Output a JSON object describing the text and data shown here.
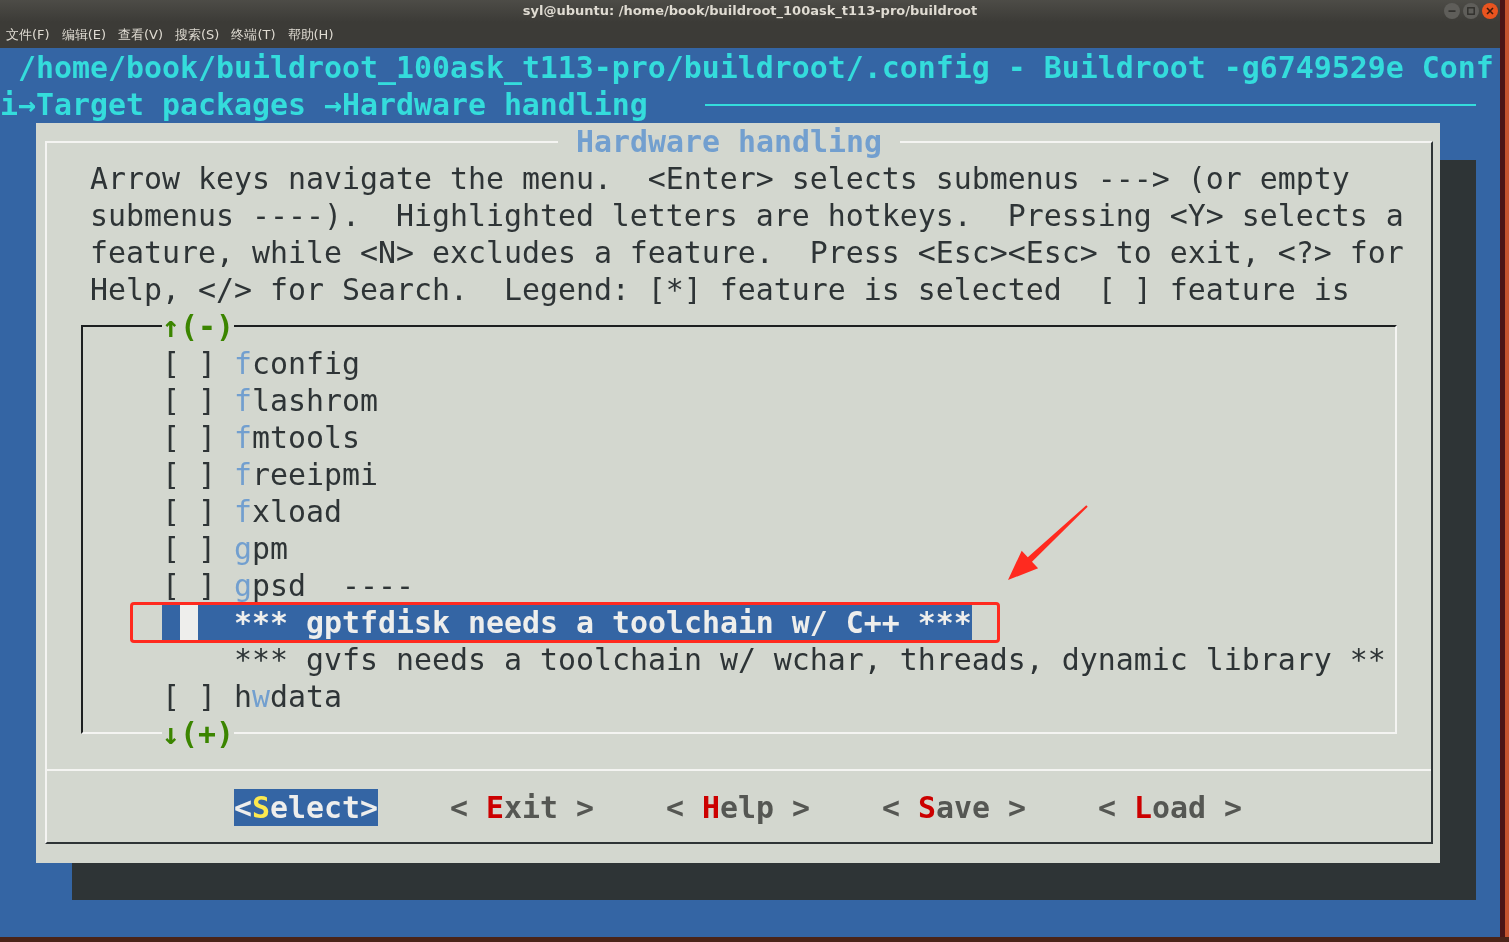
{
  "window": {
    "title": "syl@ubuntu: /home/book/buildroot_100ask_t113-pro/buildroot"
  },
  "menu_bar": [
    "文件(F)",
    "编辑(E)",
    "查看(V)",
    "搜索(S)",
    "终端(T)",
    "帮助(H)"
  ],
  "terminal": {
    "header": "/home/book/buildroot_100ask_t113-pro/buildroot/.config - Buildroot -g6749529e Conf",
    "breadcrumb": "i→Target packages →Hardware handling",
    "dialog": {
      "title": "Hardware handling",
      "help_text": "Arrow keys navigate the menu.  <Enter> selects submenus ---> (or empty submenus ----).  Highlighted letters are hotkeys.  Pressing <Y> selects a feature, while <N> excludes a feature.  Press <Esc><Esc> to exit, <?> for Help, </> for Search.  Legend: [*] feature is selected  [ ] feature is",
      "scroll_up": "↑(-)",
      "items": [
        {
          "kind": "option",
          "checkbox": "[ ]",
          "hotkey": "f",
          "after": "config",
          "selected": false
        },
        {
          "kind": "option",
          "checkbox": "[ ]",
          "hotkey": "f",
          "after": "lashrom",
          "selected": false
        },
        {
          "kind": "option",
          "checkbox": "[ ]",
          "hotkey": "f",
          "after": "mtools",
          "selected": false
        },
        {
          "kind": "option",
          "checkbox": "[ ]",
          "hotkey": "f",
          "after": "reeipmi",
          "selected": false
        },
        {
          "kind": "option",
          "checkbox": "[ ]",
          "hotkey": "f",
          "after": "xload",
          "selected": false
        },
        {
          "kind": "option",
          "checkbox": "[ ]",
          "hotkey": "g",
          "after": "pm",
          "selected": false
        },
        {
          "kind": "option",
          "checkbox": "[ ]",
          "hotkey": "g",
          "after": "psd  ----",
          "selected": false
        },
        {
          "kind": "comment",
          "text": "*** gptfdisk needs a toolchain w/ C++ ***",
          "selected": true
        },
        {
          "kind": "comment",
          "text": "*** gvfs needs a toolchain w/ wchar, threads, dynamic library **",
          "selected": false
        },
        {
          "kind": "option",
          "checkbox": "[ ]",
          "before": "h",
          "hotkey": "w",
          "after": "data",
          "selected": false
        }
      ],
      "scroll_down": "↓(+)",
      "buttons": [
        {
          "before": "<",
          "hotkey": "S",
          "after": "elect>",
          "selected": true
        },
        {
          "before": "< ",
          "hotkey": "E",
          "after": "xit >",
          "selected": false
        },
        {
          "before": "< ",
          "hotkey": "H",
          "after": "elp >",
          "selected": false
        },
        {
          "before": "< ",
          "hotkey": "S",
          "after": "ave >",
          "selected": false
        },
        {
          "before": "< ",
          "hotkey": "L",
          "after": "oad >",
          "selected": false
        }
      ]
    }
  },
  "annotations": {
    "highlight_box": true,
    "arrow": true
  }
}
